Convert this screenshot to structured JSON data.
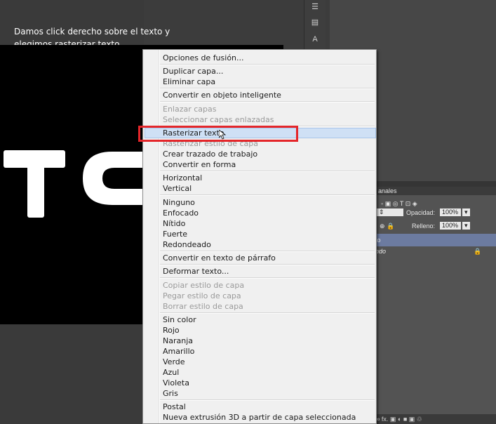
{
  "caption": {
    "line1": "Damos click derecho sobre el texto y",
    "line2": "elegimos rasterizar texto."
  },
  "canvas": {
    "letters": "TC",
    "background": "#000000",
    "letter_color": "#ffffff"
  },
  "menu": {
    "items": [
      {
        "label": "Opciones de fusión...",
        "enabled": true
      },
      {
        "label": "Duplicar capa...",
        "enabled": true
      },
      {
        "label": "Eliminar capa",
        "enabled": true
      },
      {
        "label": "Convertir en objeto inteligente",
        "enabled": true
      },
      {
        "label": "Enlazar capas",
        "enabled": false
      },
      {
        "label": "Seleccionar capas enlazadas",
        "enabled": false
      },
      {
        "label": "Rasterizar texto",
        "enabled": true,
        "highlighted": true
      },
      {
        "label": "Rasterizar estilo de capa",
        "enabled": false
      },
      {
        "label": "Crear trazado de trabajo",
        "enabled": true
      },
      {
        "label": "Convertir en forma",
        "enabled": true
      },
      {
        "label": "Horizontal",
        "enabled": true
      },
      {
        "label": "Vertical",
        "enabled": true
      },
      {
        "label": "Ninguno",
        "enabled": true
      },
      {
        "label": "Enfocado",
        "enabled": true
      },
      {
        "label": "Nítido",
        "enabled": true
      },
      {
        "label": "Fuerte",
        "enabled": true
      },
      {
        "label": "Redondeado",
        "enabled": true
      },
      {
        "label": "Convertir en texto de párrafo",
        "enabled": true
      },
      {
        "label": "Deformar texto...",
        "enabled": true
      },
      {
        "label": "Copiar estilo de capa",
        "enabled": false
      },
      {
        "label": "Pegar estilo de capa",
        "enabled": false
      },
      {
        "label": "Borrar estilo de capa",
        "enabled": false
      },
      {
        "label": "Sin color",
        "enabled": true
      },
      {
        "label": "Rojo",
        "enabled": true
      },
      {
        "label": "Naranja",
        "enabled": true
      },
      {
        "label": "Amarillo",
        "enabled": true
      },
      {
        "label": "Verde",
        "enabled": true
      },
      {
        "label": "Azul",
        "enabled": true
      },
      {
        "label": "Violeta",
        "enabled": true
      },
      {
        "label": "Gris",
        "enabled": true
      },
      {
        "label": "Postal",
        "enabled": true
      },
      {
        "label": "Nueva extrusión 3D a partir de capa seleccionada",
        "enabled": true
      }
    ],
    "highlight_color": "#cfe0f5",
    "annotation_color": "#e4262a"
  },
  "layers_panel": {
    "tab_label": "anales",
    "opacity_label": "Opacidad:",
    "opacity_value": "100%",
    "fill_label": "Relleno:",
    "fill_value": "100%",
    "row1_label": "to",
    "row2_label": "ndo",
    "bottom_icons": "∞ fx. ▣ ◐ ■ ▣ ♲"
  }
}
